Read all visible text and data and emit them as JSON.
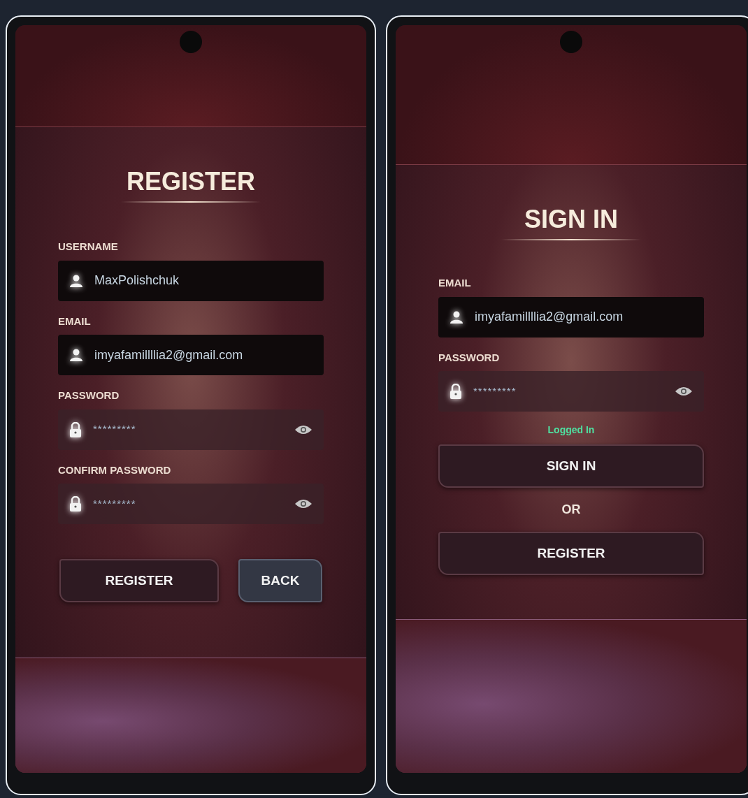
{
  "screens": [
    {
      "title": "REGISTER",
      "fields": [
        {
          "label": "USERNAME",
          "kind": "text",
          "value": "MaxPolishchuk"
        },
        {
          "label": "EMAIL",
          "kind": "text",
          "value": "imyafamillllia2@gmail.com"
        },
        {
          "label": "PASSWORD",
          "kind": "password",
          "value": "*********"
        },
        {
          "label": "CONFIRM PASSWORD",
          "kind": "password",
          "value": "*********"
        }
      ],
      "buttons": [
        {
          "label": "REGISTER",
          "kind": "primary"
        },
        {
          "label": "BACK",
          "kind": "secondary"
        }
      ]
    },
    {
      "title": "SIGN IN",
      "fields": [
        {
          "label": "EMAIL",
          "kind": "text",
          "value": "imyafamillllia2@gmail.com"
        },
        {
          "label": "PASSWORD",
          "kind": "password",
          "value": "*********"
        }
      ],
      "status": "Logged In",
      "separator": "OR",
      "buttons": [
        {
          "label": "SIGN IN",
          "kind": "primary"
        },
        {
          "label": "REGISTER",
          "kind": "primary"
        }
      ]
    }
  ]
}
